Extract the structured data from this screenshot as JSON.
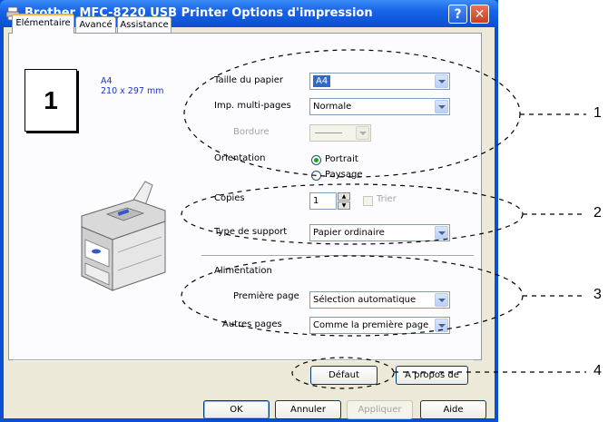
{
  "window": {
    "title": "Brother MFC-8220 USB Printer Options d'impression",
    "help_glyph": "?",
    "close_glyph": "✕"
  },
  "tabs": [
    {
      "label": "Elémentaire",
      "active": true
    },
    {
      "label": "Avancé",
      "active": false
    },
    {
      "label": "Assistance",
      "active": false
    }
  ],
  "preview": {
    "pages_per_sheet": "1",
    "paper_name": "A4",
    "paper_dims": "210 x 297 mm"
  },
  "form": {
    "paper_size": {
      "label": "Taille du papier",
      "value": "A4"
    },
    "multi_page": {
      "label": "Imp. multi-pages",
      "value": "Normale"
    },
    "border": {
      "label": "Bordure"
    },
    "orientation": {
      "label": "Orientation",
      "portrait": "Portrait",
      "landscape": "Paysage",
      "selected": "Portrait"
    },
    "copies": {
      "label": "Copies",
      "value": "1",
      "collate_label": "Trier"
    },
    "media_type": {
      "label": "Type de support",
      "value": "Papier ordinaire"
    },
    "paper_source": {
      "label": "Alimentation"
    },
    "first_page": {
      "label": "Première page",
      "value": "Sélection automatique"
    },
    "other_pages": {
      "label": "Autres pages",
      "value": "Comme la première page"
    }
  },
  "panel_buttons": {
    "default": "Défaut",
    "about": "A propos de"
  },
  "dialog_buttons": {
    "ok": "OK",
    "cancel": "Annuler",
    "apply": "Appliquer",
    "help": "Aide"
  },
  "callouts": [
    "1",
    "2",
    "3",
    "4"
  ],
  "colors": {
    "titlebar": "#0a4fd1",
    "dialog_bg": "#ece9d8",
    "selection": "#316ac5",
    "paper_info": "#1a33c8"
  }
}
